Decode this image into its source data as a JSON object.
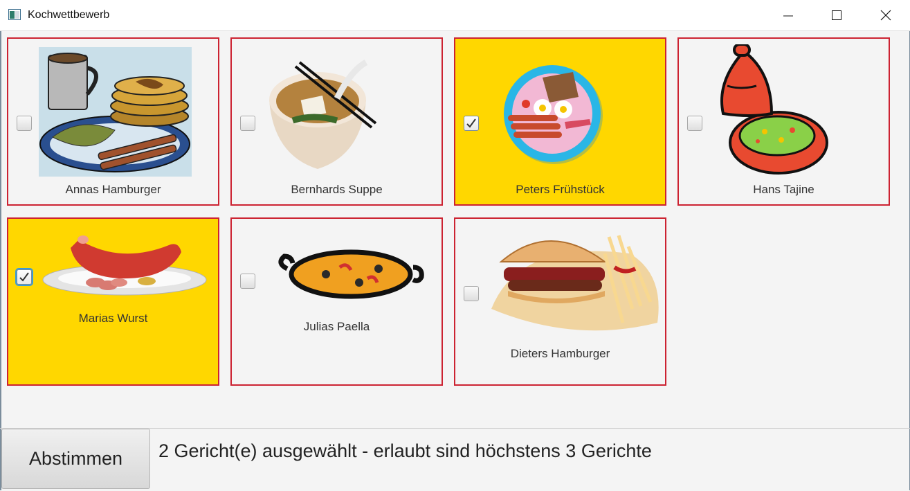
{
  "window": {
    "title": "Kochwettbewerb"
  },
  "dishes": [
    {
      "name": "Annas Hamburger",
      "selected": false,
      "icon": "pancake-breakfast-icon"
    },
    {
      "name": "Bernhards Suppe",
      "selected": false,
      "icon": "soup-bowl-icon"
    },
    {
      "name": "Peters Frühstück",
      "selected": true,
      "icon": "breakfast-plate-icon"
    },
    {
      "name": "Hans Tajine",
      "selected": false,
      "icon": "tajine-icon"
    },
    {
      "name": "Marias Wurst",
      "selected": true,
      "icon": "sausage-plate-icon"
    },
    {
      "name": "Julias Paella",
      "selected": false,
      "icon": "paella-pan-icon"
    },
    {
      "name": "Dieters Hamburger",
      "selected": false,
      "icon": "burger-fries-icon"
    }
  ],
  "footer": {
    "vote_label": "Abstimmen",
    "status": "2 Gericht(e) ausgewählt - erlaubt sind höchstens 3 Gerichte"
  },
  "colors": {
    "card_border": "#cc2231",
    "selected_bg": "#ffd700"
  }
}
